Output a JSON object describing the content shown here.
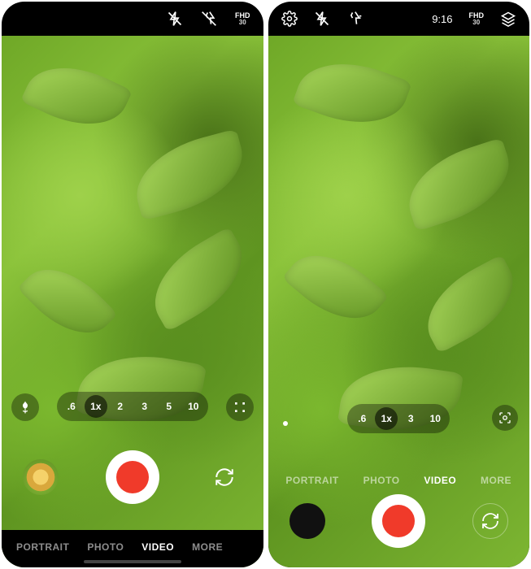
{
  "phoneA": {
    "topbar": {
      "resolution": "FHD",
      "fps": "30"
    },
    "zoom": [
      ".6",
      "1x",
      "2",
      "3",
      "5",
      "10"
    ],
    "zoom_active_index": 1,
    "modes": [
      "PORTRAIT",
      "PHOTO",
      "VIDEO",
      "MORE"
    ],
    "mode_active_index": 2
  },
  "phoneB": {
    "topbar": {
      "time": "9:16",
      "resolution": "FHD",
      "fps": "30"
    },
    "zoom": [
      ".6",
      "1x",
      "3",
      "10"
    ],
    "zoom_active_index": 1,
    "modes": [
      "PORTRAIT",
      "PHOTO",
      "VIDEO",
      "MORE"
    ],
    "mode_active_index": 2
  }
}
